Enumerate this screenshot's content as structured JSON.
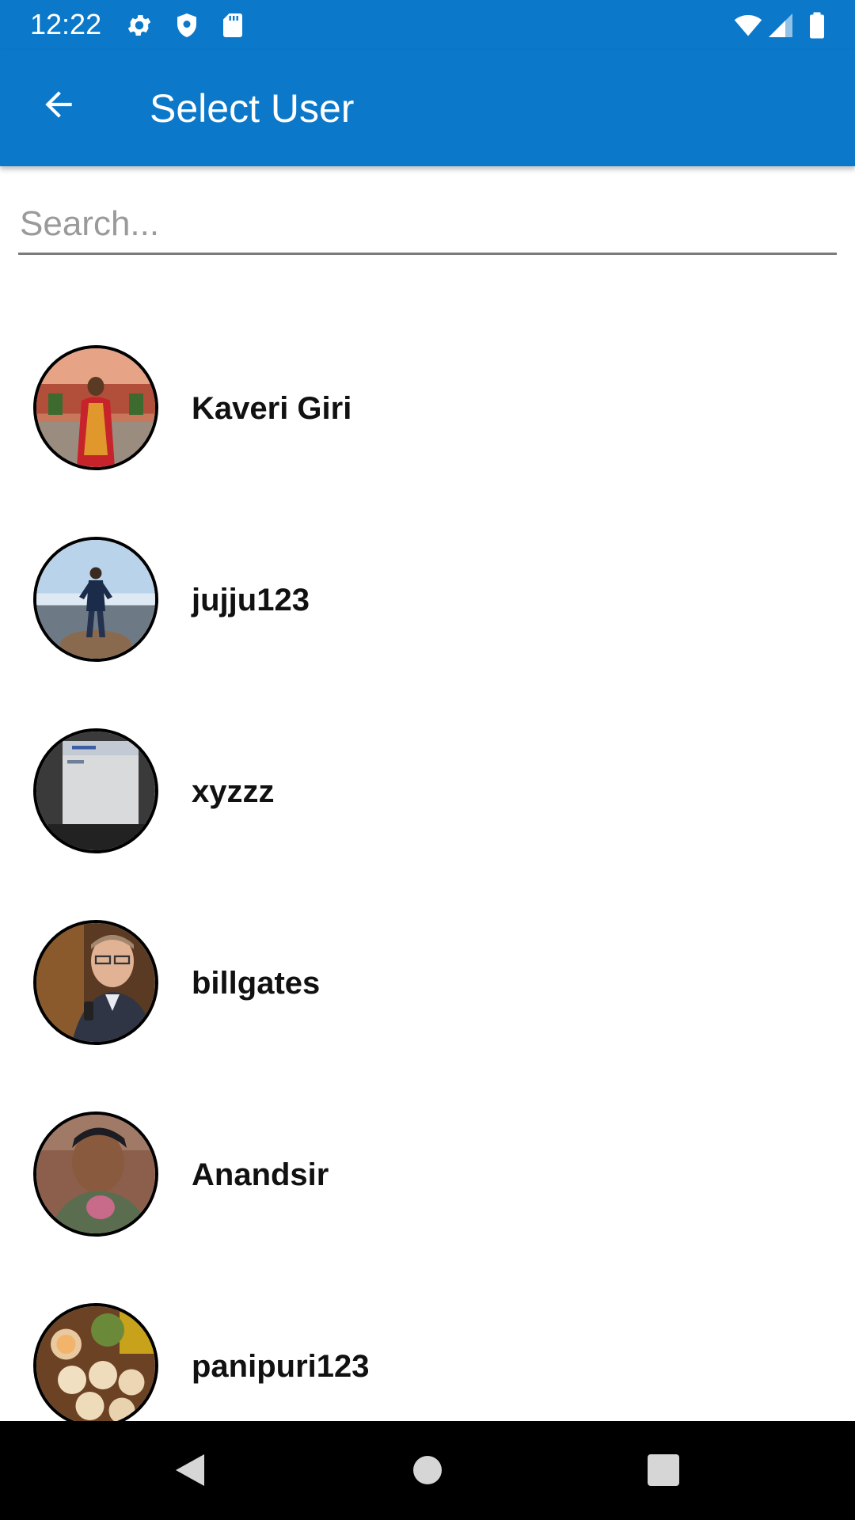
{
  "status_bar": {
    "time": "12:22",
    "icons": [
      "gear-icon",
      "shield-icon",
      "sd-card-icon",
      "wifi-icon",
      "signal-icon",
      "battery-icon"
    ]
  },
  "app_bar": {
    "title": "Select User",
    "back_icon": "arrow-back-icon",
    "color": "#0c78c9"
  },
  "search": {
    "placeholder": "Search...",
    "value": ""
  },
  "users": [
    {
      "name": "Kaveri Giri"
    },
    {
      "name": "jujju123"
    },
    {
      "name": "xyzzz"
    },
    {
      "name": "billgates"
    },
    {
      "name": "Anandsir"
    },
    {
      "name": "panipuri123"
    }
  ],
  "nav_bar": {
    "icons": [
      "back-triangle-icon",
      "home-circle-icon",
      "recents-square-icon"
    ]
  }
}
